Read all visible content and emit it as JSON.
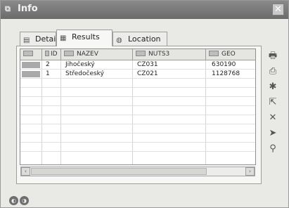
{
  "window": {
    "title": "Info",
    "title_icon": "map-layers-icon",
    "close_glyph": "✕"
  },
  "tabs": [
    {
      "label": "Details",
      "icon": "details-icon",
      "active": false
    },
    {
      "label": "Results",
      "icon": "table-icon",
      "active": true
    },
    {
      "label": "Location",
      "icon": "globe-icon",
      "active": false
    }
  ],
  "table": {
    "columns": [
      "",
      "ID",
      "NAZEV",
      "NUTS3",
      "GEO"
    ],
    "rows": [
      {
        "id": "2",
        "nazev": "Jihočeský",
        "nuts3": "CZ031",
        "geo": "630190"
      },
      {
        "id": "1",
        "nazev": "Středočeský",
        "nuts3": "CZ021",
        "geo": "1128768"
      }
    ]
  },
  "scrollbar": {
    "left_arrow": "‹",
    "right_arrow": "›"
  },
  "toolbar": [
    {
      "name": "export-icon",
      "glyph": "🖶"
    },
    {
      "name": "print-icon",
      "glyph": "⎙"
    },
    {
      "name": "star-icon",
      "glyph": "✱"
    },
    {
      "name": "zoom-to-icon",
      "glyph": "⇱"
    },
    {
      "name": "clear-selection-icon",
      "glyph": "✕"
    },
    {
      "name": "pointer-icon",
      "glyph": "➤"
    },
    {
      "name": "pin-icon",
      "glyph": "⚲"
    }
  ],
  "colors": {
    "titlebar": "#777777",
    "swatch": "#a9a9a9"
  }
}
